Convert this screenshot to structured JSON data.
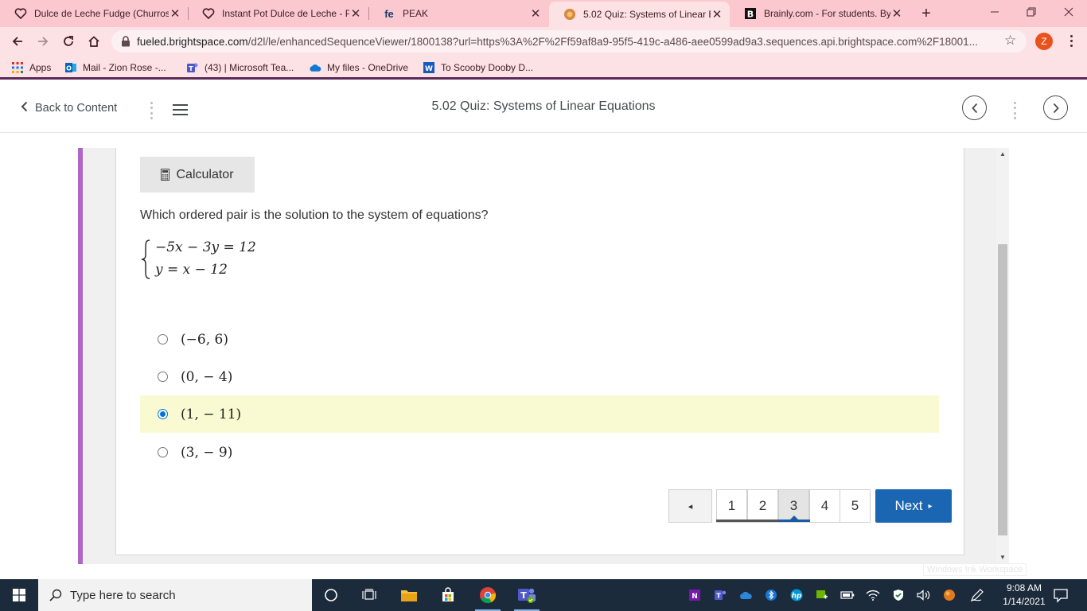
{
  "browser": {
    "tabs": [
      {
        "title": "Dulce de Leche Fudge (Churros",
        "icon": "pinterest-icon",
        "active": false
      },
      {
        "title": "Instant Pot Dulce de Leche - Pi",
        "icon": "pinterest-icon",
        "active": false
      },
      {
        "title": "PEAK",
        "icon": "fe-icon",
        "active": false
      },
      {
        "title": "5.02 Quiz: Systems of Linear Eq",
        "icon": "brightspace-icon",
        "active": true
      },
      {
        "title": "Brainly.com - For students. By",
        "icon": "brainly-icon",
        "active": false
      }
    ],
    "url_host": "fueled.brightspace.com",
    "url_path": "/d2l/le/enhancedSequenceViewer/1800138?url=https%3A%2F%2Ff59af8a9-95f5-419c-a486-aee0599ad9a3.sequences.api.brightspace.com%2F18001...",
    "profile_initial": "Z",
    "bookmarks": [
      {
        "label": "Apps",
        "icon": "apps-grid-icon"
      },
      {
        "label": "Mail - Zion Rose -...",
        "icon": "outlook-icon"
      },
      {
        "label": "(43) | Microsoft Tea...",
        "icon": "teams-icon"
      },
      {
        "label": "My files - OneDrive",
        "icon": "onedrive-icon"
      },
      {
        "label": "To Scooby Dooby D...",
        "icon": "word-icon"
      }
    ]
  },
  "header": {
    "back_label": "Back to Content",
    "title": "5.02 Quiz: Systems of Linear Equations"
  },
  "quiz": {
    "calculator_label": "Calculator",
    "question": "Which ordered pair is the solution to the system of equations?",
    "equations": [
      "−5x − 3y = 12",
      "y = x − 12"
    ],
    "options": [
      {
        "label": "(−6,  6)",
        "selected": false
      },
      {
        "label": "(0,  − 4)",
        "selected": false
      },
      {
        "label": "(1,  − 11)",
        "selected": true
      },
      {
        "label": "(3,  − 9)",
        "selected": false
      }
    ],
    "pagination": {
      "prev_symbol": "◂",
      "pages": [
        "1",
        "2",
        "3",
        "4",
        "5"
      ],
      "current": "3",
      "next_label": "Next",
      "next_symbol": "▸"
    }
  },
  "watermark": "Windows Ink Workspace",
  "taskbar": {
    "search_placeholder": "Type here to search",
    "time": "9:08 AM",
    "date": "1/14/2021"
  },
  "colors": {
    "tabstrip": "#fbc8cf",
    "toolbar": "#fde2e5",
    "accent_purple": "#b066c4",
    "next_button": "#1a66b3",
    "selected_row": "#fafad2",
    "taskbar": "#1c2b3c"
  }
}
